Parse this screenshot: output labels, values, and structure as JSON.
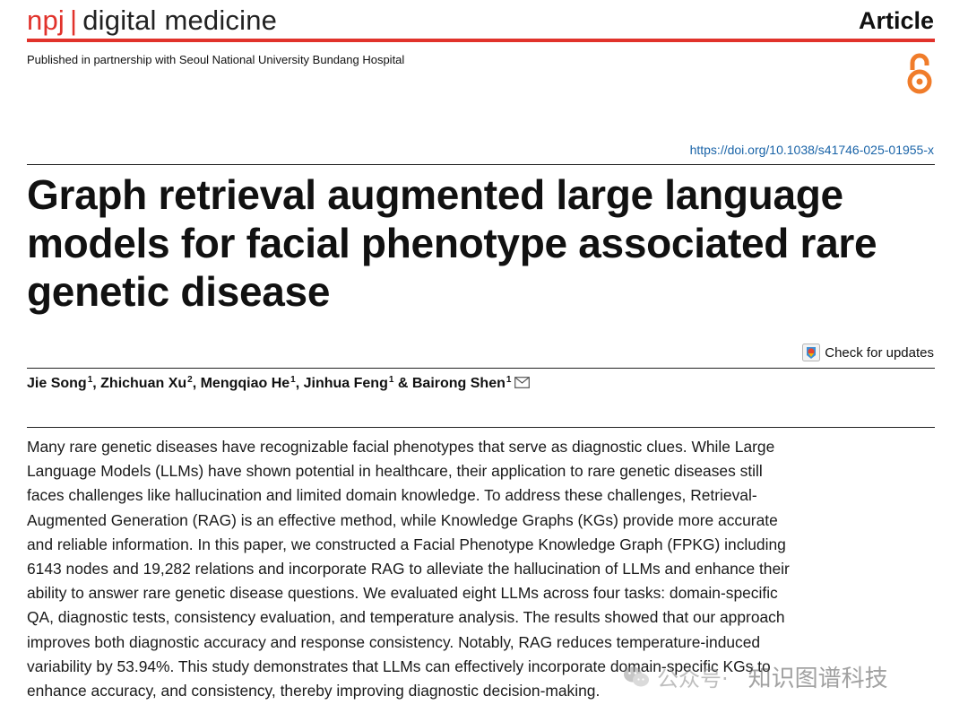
{
  "header": {
    "journal_prefix": "npj",
    "journal_separator": "|",
    "journal_name": "digital medicine",
    "article_type": "Article",
    "partnership": "Published in partnership with Seoul National University Bundang Hospital",
    "accent_color": "#e1322b",
    "open_access_icon": "open-access-lock-icon"
  },
  "doi": "https://doi.org/10.1038/s41746-025-01955-x",
  "title": "Graph retrieval augmented large language models for facial phenotype associated rare genetic disease",
  "check_updates": {
    "label": "Check for updates",
    "icon": "crossmark-icon"
  },
  "authors": [
    {
      "name": "Jie Song",
      "aff": "1"
    },
    {
      "name": "Zhichuan Xu",
      "aff": "2"
    },
    {
      "name": "Mengqiao He",
      "aff": "1"
    },
    {
      "name": "Jinhua Feng",
      "aff": "1"
    },
    {
      "name": "Bairong Shen",
      "aff": "1"
    }
  ],
  "author_separators": [
    ", ",
    ", ",
    ", ",
    " & "
  ],
  "corresponding_icon": "envelope-icon",
  "abstract": "Many rare genetic diseases have recognizable facial phenotypes that serve as diagnostic clues. While Large Language Models (LLMs) have shown potential in healthcare, their application to rare genetic diseases still faces challenges like hallucination and limited domain knowledge. To address these challenges, Retrieval-Augmented Generation (RAG) is an effective method, while Knowledge Graphs (KGs) provide more accurate and reliable information. In this paper, we constructed a Facial Phenotype Knowledge Graph (FPKG) including 6143 nodes and 19,282 relations and incorporate RAG to alleviate the hallucination of LLMs and enhance their ability to answer rare genetic disease questions. We evaluated eight LLMs across four tasks: domain-specific QA, diagnostic tests, consistency evaluation, and temperature analysis. The results showed that our approach improves both diagnostic accuracy and response consistency. Notably, RAG reduces temperature-induced variability by 53.94%. This study demonstrates that LLMs can effectively incorporate domain-specific KGs to enhance accuracy, and consistency, thereby improving diagnostic decision-making.",
  "watermark": {
    "icon": "wechat-icon",
    "prefix": "公众号·",
    "name": "知识图谱科技"
  }
}
